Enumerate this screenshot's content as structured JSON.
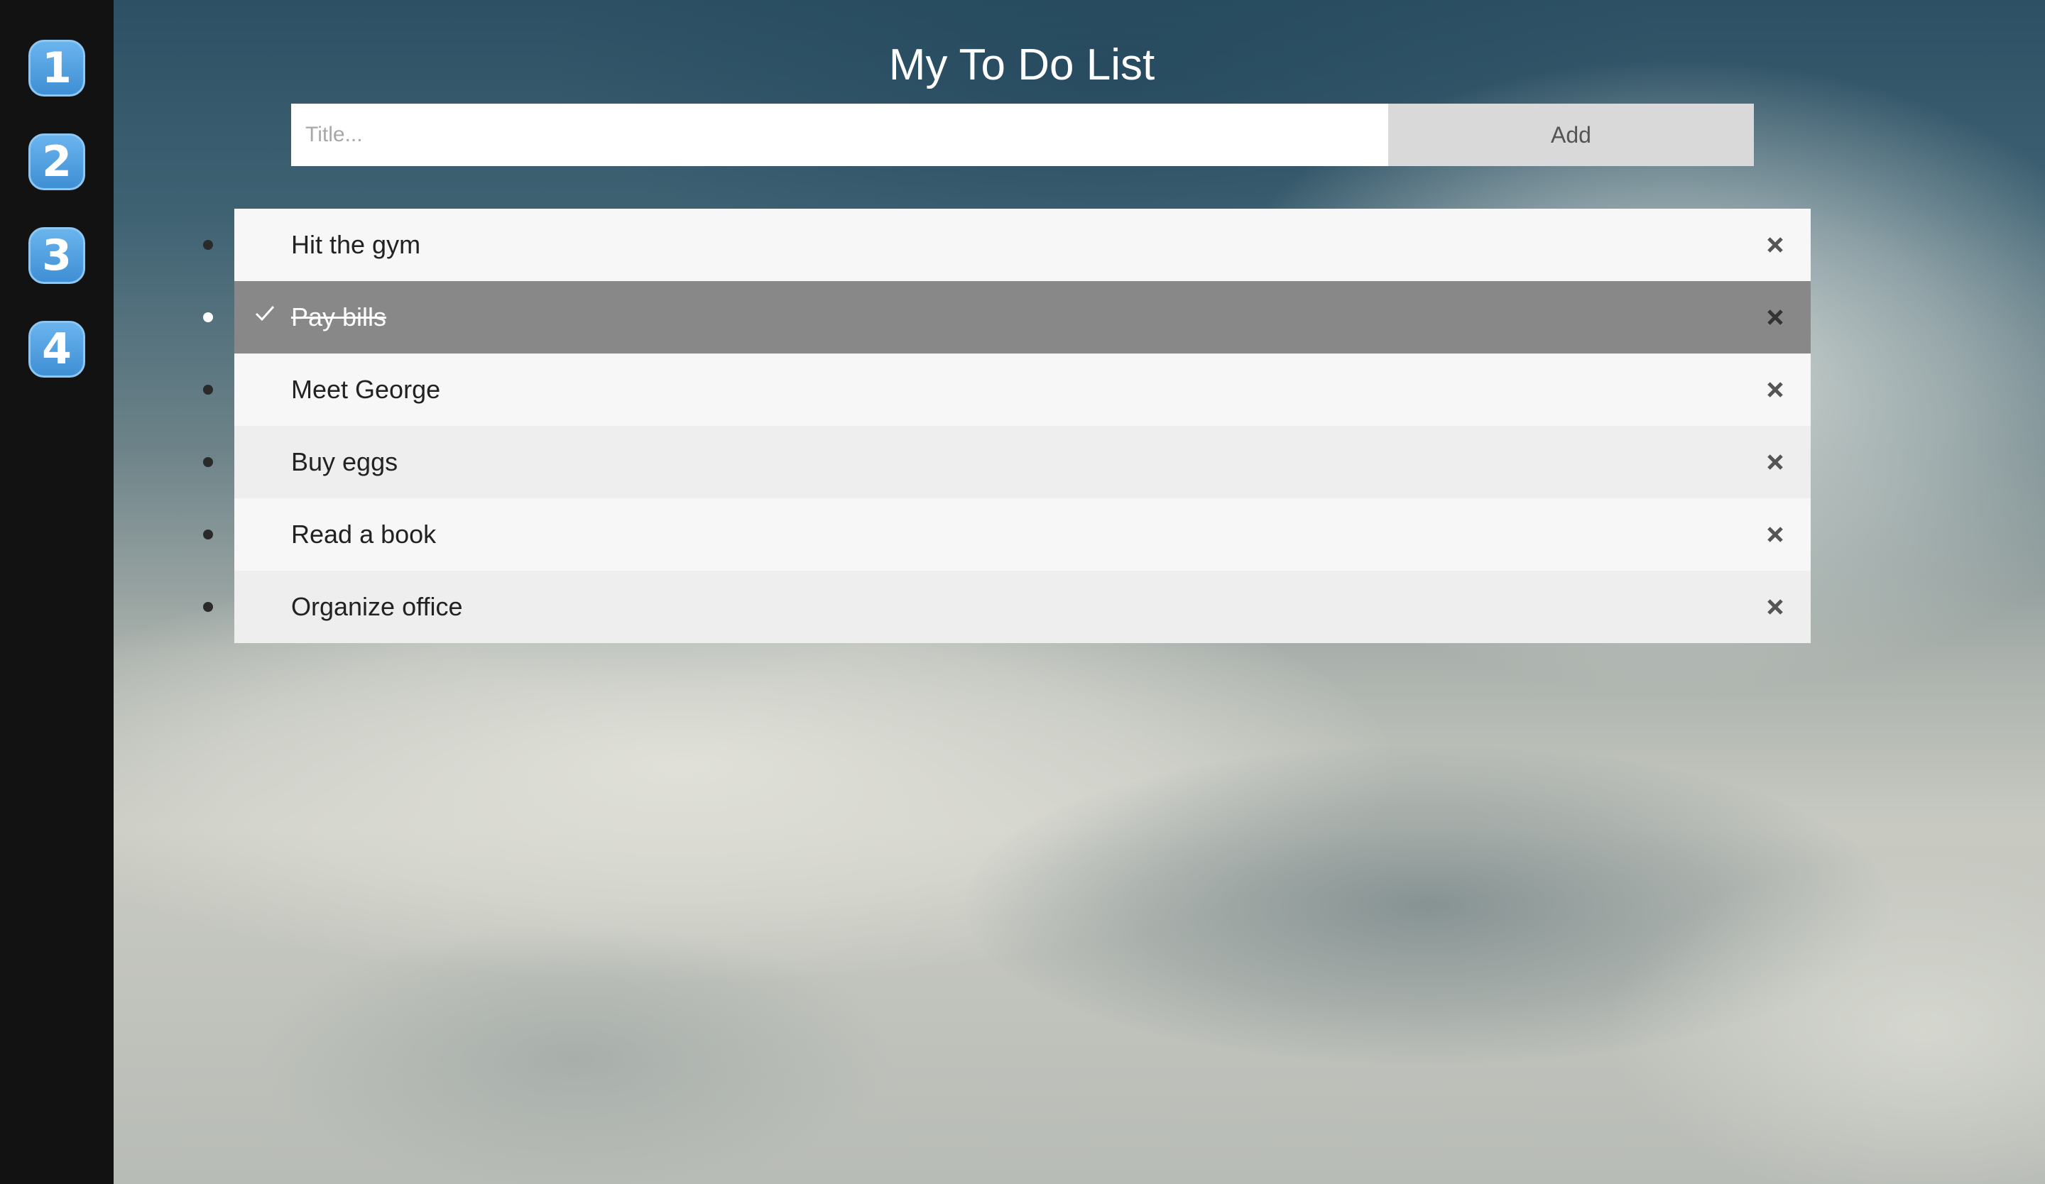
{
  "sidebar": {
    "steps": [
      "1",
      "2",
      "3",
      "4"
    ]
  },
  "header": {
    "title": "My To Do List",
    "input_placeholder": "Title...",
    "input_value": "",
    "add_label": "Add"
  },
  "todos": [
    {
      "text": "Hit the gym",
      "checked": false
    },
    {
      "text": "Pay bills",
      "checked": true
    },
    {
      "text": "Meet George",
      "checked": false
    },
    {
      "text": "Buy eggs",
      "checked": false
    },
    {
      "text": "Read a book",
      "checked": false
    },
    {
      "text": "Organize office",
      "checked": false
    }
  ],
  "icons": {
    "check": "check-icon",
    "close": "close-icon"
  },
  "colors": {
    "checked_row": "#888888",
    "row_odd": "#f7f7f7",
    "row_even": "#eeeeee",
    "add_button": "#d9d9d9",
    "step_badge": "#4c9ede"
  }
}
